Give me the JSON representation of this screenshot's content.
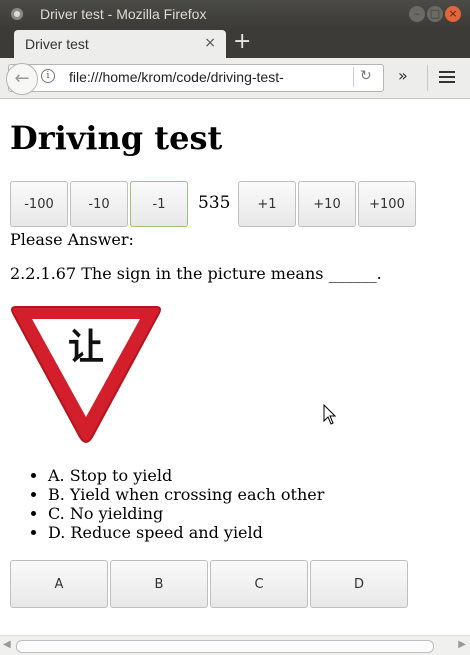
{
  "window": {
    "title": "Driver test - Mozilla Firefox"
  },
  "tab": {
    "label": "Driver test",
    "close": "×"
  },
  "newtab": "+",
  "nav": {
    "back": "←",
    "url": "file:///home/krom/code/driving-test-",
    "reload": "↻",
    "overflow": "»"
  },
  "page": {
    "heading": "Driving test",
    "steppers": [
      "-100",
      "-10",
      "-1",
      "+1",
      "+10",
      "+100"
    ],
    "counter": "535",
    "prompt": "Please Answer:",
    "question": "2.2.1.67 The sign in the picture means ______.",
    "sign_text": "让",
    "options": [
      "A. Stop to yield",
      "B. Yield when crossing each other",
      "C. No yielding",
      "D. Reduce speed and yield"
    ],
    "answers": [
      "A",
      "B",
      "C",
      "D"
    ]
  },
  "colors": {
    "sign_red": "#d21f2b",
    "active_border": "#9bc37a"
  },
  "icons": [
    "back-arrow-icon",
    "info-icon",
    "reload-icon",
    "overflow-icon",
    "hamburger-menu-icon"
  ]
}
